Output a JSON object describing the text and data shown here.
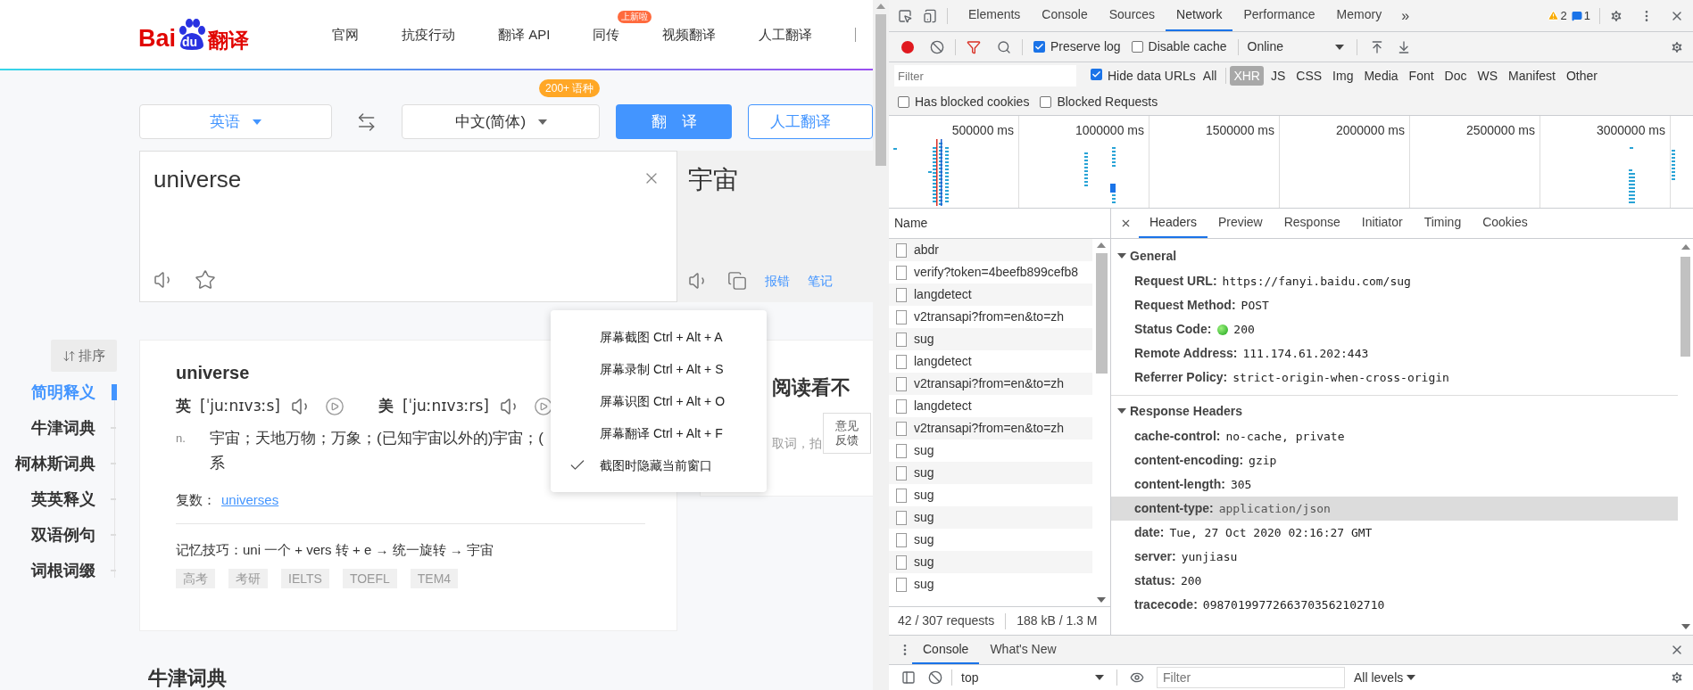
{
  "page": {
    "logo": {
      "left": "Bai",
      "paw": "du",
      "right": "翻译"
    },
    "nav": [
      {
        "label": "官网"
      },
      {
        "label": "抗疫行动"
      },
      {
        "label": "翻译 API"
      },
      {
        "label": "同传",
        "badge": "上新啦"
      },
      {
        "label": "视频翻译"
      },
      {
        "label": "人工翻译"
      }
    ],
    "source_language": "英语",
    "language_count_badge": "200+ 语种",
    "target_language": "中文(简体)",
    "translate_button": "翻　译",
    "human_translation_button": "人工翻译",
    "input_text": "universe",
    "output_text": "宇宙",
    "output_links": [
      "报错",
      "笔记"
    ],
    "sort_button": "排序",
    "sidebar": [
      {
        "label": "简明释义",
        "selected": true
      },
      {
        "label": "牛津词典",
        "selected": false
      },
      {
        "label": "柯林斯词典",
        "selected": false
      },
      {
        "label": "英英释义",
        "selected": false
      },
      {
        "label": "双语例句",
        "selected": false
      },
      {
        "label": "词根词缀",
        "selected": false
      }
    ],
    "entry": {
      "word": "universe",
      "pronunciations": [
        {
          "region": "英",
          "phonetic": "[ˈjuːnɪvɜːs]"
        },
        {
          "region": "美",
          "phonetic": "[ˈjuːnɪvɜːrs]"
        }
      ],
      "part_of_speech": "n.",
      "meaning_lines": [
        "宇宙；天地万物；万象；(已知宇宙以外的)宇宙；(",
        "系"
      ],
      "plural_label": "复数：",
      "plural_link": "universes",
      "memory_tip": "记忆技巧：uni 一个 + vers 转 + e → 统一旋转 → 宇宙",
      "tags": [
        "高考",
        "考研",
        "IELTS",
        "TOEFL",
        "TEM4"
      ]
    },
    "next_section_title": "牛津词典",
    "promo": {
      "title": "阅读看不",
      "subtitle": "取词，拍"
    },
    "feedback_button": "意见反馈",
    "context_menu": [
      {
        "label": "屏幕截图 Ctrl + Alt + A",
        "checked": false
      },
      {
        "label": "屏幕录制 Ctrl + Alt + S",
        "checked": false
      },
      {
        "label": "屏幕识图 Ctrl + Alt + O",
        "checked": false
      },
      {
        "label": "屏幕翻译 Ctrl + Alt + F",
        "checked": false
      },
      {
        "label": "截图时隐藏当前窗口",
        "checked": true
      }
    ]
  },
  "devtools": {
    "tabs": [
      {
        "label": "Elements",
        "selected": false
      },
      {
        "label": "Console",
        "selected": false
      },
      {
        "label": "Sources",
        "selected": false
      },
      {
        "label": "Network",
        "selected": true
      },
      {
        "label": "Performance",
        "selected": false
      },
      {
        "label": "Memory",
        "selected": false
      }
    ],
    "more_tabs": "»",
    "warning_count": "2",
    "message_count": "1",
    "toolbar": {
      "checkboxes": [
        {
          "label": "Preserve log",
          "checked": true
        },
        {
          "label": "Disable cache",
          "checked": false
        }
      ],
      "throttling": "Online"
    },
    "filter": {
      "placeholder": "Filter",
      "hide_data_urls": {
        "label": "Hide data URLs",
        "checked": true
      },
      "types": [
        {
          "label": "All",
          "selected": false
        },
        {
          "label": "XHR",
          "selected": true
        },
        {
          "label": "JS",
          "selected": false
        },
        {
          "label": "CSS",
          "selected": false
        },
        {
          "label": "Img",
          "selected": false
        },
        {
          "label": "Media",
          "selected": false
        },
        {
          "label": "Font",
          "selected": false
        },
        {
          "label": "Doc",
          "selected": false
        },
        {
          "label": "WS",
          "selected": false
        },
        {
          "label": "Manifest",
          "selected": false
        },
        {
          "label": "Other",
          "selected": false
        }
      ]
    },
    "blocked_filters": [
      {
        "label": "Has blocked cookies",
        "checked": false
      },
      {
        "label": "Blocked Requests",
        "checked": false
      }
    ],
    "overview_ticks": [
      "500000 ms",
      "1000000 ms",
      "1500000 ms",
      "2000000 ms",
      "2500000 ms",
      "3000000 ms"
    ],
    "requests": {
      "column": "Name",
      "rows": [
        "abdr",
        "verify?token=4beefb899cefb8",
        "langdetect",
        "v2transapi?from=en&to=zh",
        "sug",
        "langdetect",
        "v2transapi?from=en&to=zh",
        "langdetect",
        "v2transapi?from=en&to=zh",
        "sug",
        "sug",
        "sug",
        "sug",
        "sug",
        "sug",
        "sug"
      ],
      "summary": [
        "42 / 307 requests",
        "188 kB / 1.3 M"
      ]
    },
    "detail_tabs": [
      {
        "label": "Headers",
        "selected": true
      },
      {
        "label": "Preview",
        "selected": false
      },
      {
        "label": "Response",
        "selected": false
      },
      {
        "label": "Initiator",
        "selected": false
      },
      {
        "label": "Timing",
        "selected": false
      },
      {
        "label": "Cookies",
        "selected": false
      }
    ],
    "sections": [
      {
        "title": "General",
        "expanded": true,
        "rows": [
          {
            "kind": "plain",
            "key": "Request URL:",
            "value": "https://fanyi.baidu.com/sug",
            "highlighted": false
          },
          {
            "kind": "plain",
            "key": "Request Method:",
            "value": "POST",
            "highlighted": false
          },
          {
            "kind": "status",
            "key": "Status Code:",
            "value": "200",
            "highlighted": false
          },
          {
            "kind": "plain",
            "key": "Remote Address:",
            "value": "111.174.61.202:443",
            "highlighted": false
          },
          {
            "kind": "plain",
            "key": "Referrer Policy:",
            "value": "strict-origin-when-cross-origin",
            "highlighted": false
          }
        ]
      },
      {
        "title": "Response Headers",
        "expanded": true,
        "rows": [
          {
            "kind": "plain",
            "key": "cache-control:",
            "value": "no-cache, private",
            "highlighted": false
          },
          {
            "kind": "plain",
            "key": "content-encoding:",
            "value": "gzip",
            "highlighted": false
          },
          {
            "kind": "plain",
            "key": "content-length:",
            "value": "305",
            "highlighted": false
          },
          {
            "kind": "plain",
            "key": "content-type:",
            "value": "application/json",
            "highlighted": true
          },
          {
            "kind": "plain",
            "key": "date:",
            "value": "Tue, 27 Oct 2020 02:16:27 GMT",
            "highlighted": false
          },
          {
            "kind": "plain",
            "key": "server:",
            "value": "yunjiasu",
            "highlighted": false
          },
          {
            "kind": "plain",
            "key": "status:",
            "value": "200",
            "highlighted": false
          },
          {
            "kind": "plain",
            "key": "tracecode:",
            "value": "09870199772663703562102710",
            "highlighted": false
          }
        ]
      }
    ],
    "drawer": {
      "tabs": [
        {
          "label": "Console",
          "selected": true
        },
        {
          "label": "What's New",
          "selected": false
        }
      ],
      "context": "top",
      "filter_placeholder": "Filter",
      "levels": "All levels"
    }
  }
}
